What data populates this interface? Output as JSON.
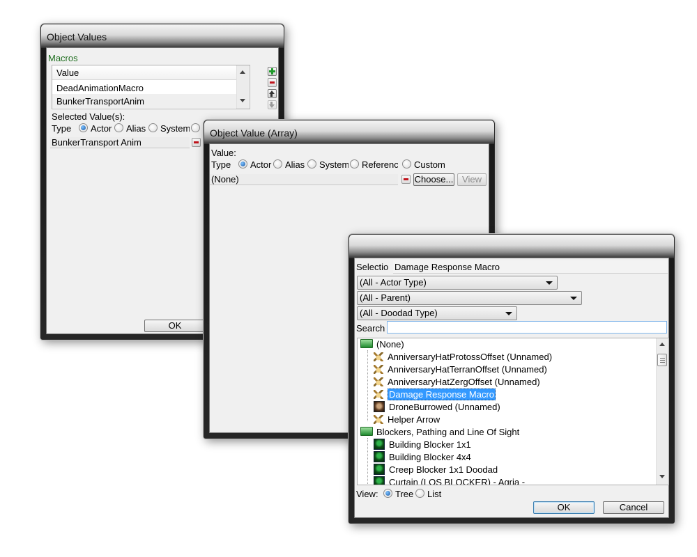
{
  "win1": {
    "title": "Object Values",
    "section": "Macros",
    "list_header": "Value",
    "rows": [
      "DeadAnimationMacro",
      "BunkerTransportAnim"
    ],
    "selected_label": "Selected Value(s):",
    "type_label": "Type",
    "radios": [
      "Actor",
      "Alias",
      "System"
    ],
    "value_field": "BunkerTransport Anim",
    "ok": "OK"
  },
  "win2": {
    "title": "Object Value (Array)",
    "value_label": "Value:",
    "type_label": "Type",
    "radios": [
      "Actor",
      "Alias",
      "System",
      "Referenc",
      "Custom"
    ],
    "value_field": "(None)",
    "choose": "Choose...",
    "view": "View"
  },
  "win3": {
    "selection_label": "Selectio",
    "selection_value": "Damage Response Macro",
    "filters": [
      "(All - Actor Type)",
      "(All - Parent)",
      "(All - Doodad Type)"
    ],
    "search_label": "Search",
    "search_value": "",
    "tree": [
      {
        "label": "(None)",
        "icon": "folder-icon",
        "level": 0
      },
      {
        "label": "AnniversaryHatProtossOffset (Unnamed)",
        "icon": "actor-icon",
        "level": 1
      },
      {
        "label": "AnniversaryHatTerranOffset (Unnamed)",
        "icon": "actor-icon",
        "level": 1
      },
      {
        "label": "AnniversaryHatZergOffset (Unnamed)",
        "icon": "actor-icon",
        "level": 1
      },
      {
        "label": "Damage Response Macro",
        "icon": "actor-icon",
        "level": 1,
        "selected": true
      },
      {
        "label": "DroneBurrowed (Unnamed)",
        "icon": "drone-icon",
        "level": 1
      },
      {
        "label": "Helper Arrow",
        "icon": "actor-icon",
        "level": 1
      },
      {
        "label": "Blockers, Pathing and Line Of Sight",
        "icon": "folder-icon",
        "level": 0
      },
      {
        "label": "Building Blocker 1x1",
        "icon": "model-icon",
        "level": 1
      },
      {
        "label": "Building Blocker 4x4",
        "icon": "model-icon",
        "level": 1
      },
      {
        "label": "Creep Blocker 1x1 Doodad",
        "icon": "model-icon",
        "level": 1
      },
      {
        "label": "Curtain (LOS BLOCKER) - Agria -",
        "icon": "model-icon",
        "level": 1
      }
    ],
    "view_label": "View:",
    "view_options": [
      "Tree",
      "List"
    ],
    "ok": "OK",
    "cancel": "Cancel"
  },
  "colors": {
    "selection_blue": "#3399ff",
    "macros_green": "#1f6e1f"
  }
}
